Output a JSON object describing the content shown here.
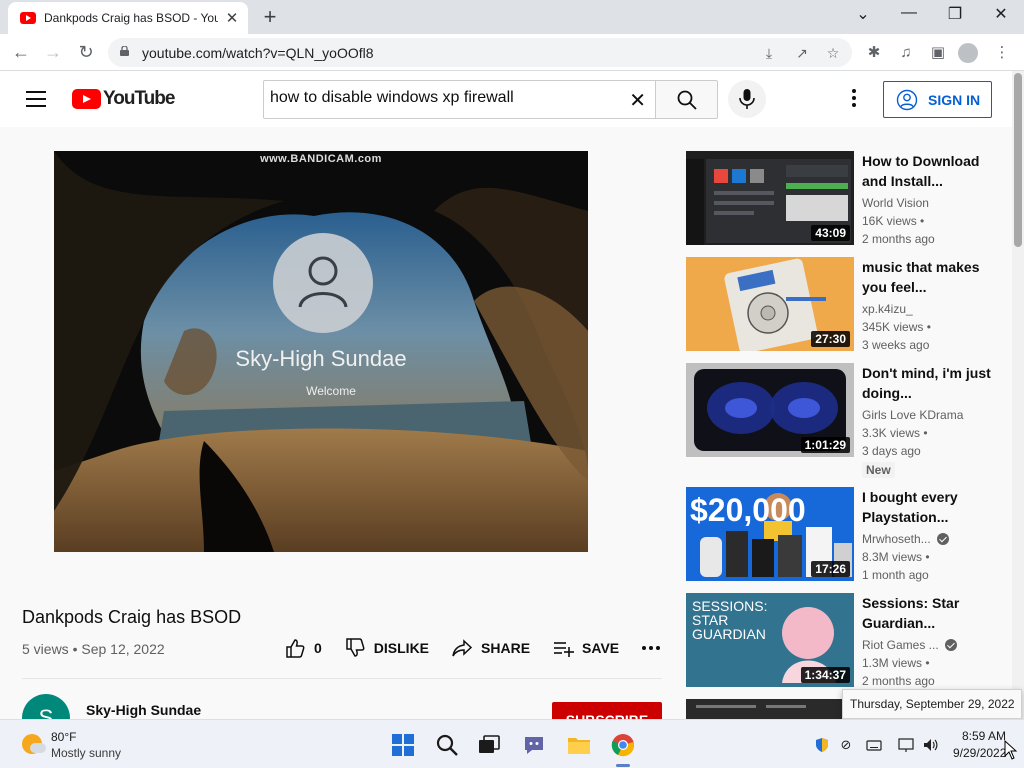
{
  "browser": {
    "tab_title": "Dankpods Craig has BSOD - YouTube",
    "url": "youtube.com/watch?v=QLN_yoOOfl8"
  },
  "header": {
    "logo_text": "YouTube",
    "search_value": "how to disable windows xp firewall",
    "signin_label": "SIGN IN"
  },
  "video": {
    "watermark": "www.BANDICAM.com",
    "screen_user": "Sky-High Sundae",
    "screen_status": "Welcome",
    "title": "Dankpods Craig has BSOD",
    "meta": "5 views • Sep 12, 2022",
    "like_count": "0",
    "dislike_label": "DISLIKE",
    "share_label": "SHARE",
    "save_label": "SAVE",
    "channel_name": "Sky-High Sundae",
    "channel_initial": "S",
    "subscribe_label": "SUBSCRIBE"
  },
  "recommendations": [
    {
      "title": "How to Download and Install...",
      "channel": "World Vision",
      "verified": false,
      "views": "16K views •",
      "age": "2 months ago",
      "duration": "43:09"
    },
    {
      "title": "music that makes you feel...",
      "channel": "xp.k4izu_",
      "verified": false,
      "views": "345K views •",
      "age": "3 weeks ago",
      "duration": "27:30"
    },
    {
      "title": "Don't mind, i'm just doing...",
      "channel": "Girls Love KDrama",
      "verified": false,
      "views": "3.3K views •",
      "age": "3 days ago",
      "duration": "1:01:29",
      "badge": "New"
    },
    {
      "title": "I bought every Playstation...",
      "channel": "Mrwhoseth...",
      "verified": true,
      "views": "8.3M views •",
      "age": "1 month ago",
      "duration": "17:26",
      "thumb_text": "$20,000"
    },
    {
      "title": "Sessions: Star Guardian...",
      "channel": "Riot Games ...",
      "verified": true,
      "views": "1.3M views •",
      "age": "2 months ago",
      "duration": "1:34:37",
      "thumb_text_1": "SESSIONS:",
      "thumb_text_2": "STAR",
      "thumb_text_3": "GUARDIAN"
    }
  ],
  "tooltip": "Thursday, September 29, 2022",
  "taskbar": {
    "temperature": "80°F",
    "condition": "Mostly sunny",
    "time": "8:59 AM",
    "date": "9/29/2022"
  },
  "colors": {
    "youtube_red": "#ff0000",
    "signin_blue": "#065fd4",
    "subscribe_red": "#cc0000"
  }
}
